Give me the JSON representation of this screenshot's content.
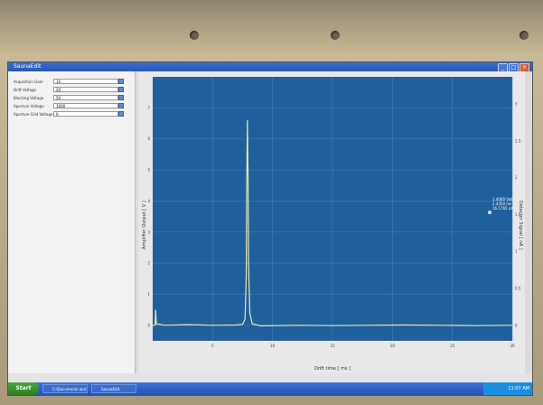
{
  "window": {
    "title": "SaunaEdit"
  },
  "window_buttons": [
    "_",
    "□",
    "×"
  ],
  "sidebar": {
    "fields": [
      {
        "label": "Acquisition Gain",
        "value": "10"
      },
      {
        "label": "Drift Voltage",
        "value": "20"
      },
      {
        "label": "Blocking Voltage",
        "value": "50"
      },
      {
        "label": "Aperture Voltage",
        "value": "1000"
      },
      {
        "label": "Aperture Grid Voltage",
        "value": "0"
      }
    ]
  },
  "taskbar": {
    "start_label": "Start",
    "items": [
      "C:\\Documents and S...",
      "SaunaEdit"
    ],
    "clock": "11:07 AM"
  },
  "chart_data": {
    "type": "line",
    "title": "",
    "xlabel": "Drift time [ ms ]",
    "ylabel": "Amplifier Output [ V ]",
    "y2label": "Detector Signal [ nA ]",
    "xlim": [
      0,
      30
    ],
    "ylim": [
      -0.5,
      8
    ],
    "x_ticks": [
      5,
      10,
      15,
      20,
      25,
      30
    ],
    "y_ticks": [
      0,
      1,
      2,
      3,
      4,
      5,
      6,
      7
    ],
    "y2_ticks": [
      0,
      0.5,
      1,
      1.5,
      2,
      2.5,
      3
    ],
    "grid": true,
    "background": "#1f5f9c",
    "line_color": "#e3e7b0",
    "series": [
      {
        "x": [
          0,
          0.2,
          0.25,
          0.3,
          1,
          3,
          5,
          7,
          7.5,
          7.7,
          7.8,
          7.85,
          7.9,
          7.95,
          8.0,
          8.1,
          8.3,
          9,
          12,
          15,
          18,
          21,
          24,
          27,
          30
        ],
        "y": [
          0,
          0,
          0.5,
          0.05,
          0,
          0.02,
          0,
          0.01,
          0.03,
          0.2,
          1.5,
          4.5,
          6.6,
          5,
          2,
          0.4,
          0.05,
          -0.02,
          0,
          -0.01,
          0,
          0.01,
          0,
          -0.01,
          0
        ]
      }
    ],
    "annotation": {
      "lines": [
        "1.4000 Volt",
        "2.4350 ms",
        "16.1765 nA"
      ]
    }
  }
}
